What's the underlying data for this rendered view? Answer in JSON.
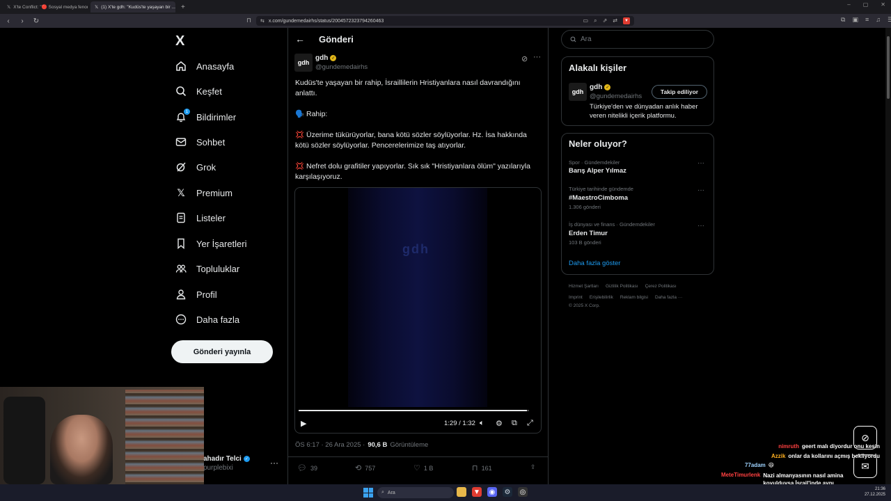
{
  "browser": {
    "tabs": [
      {
        "label": "X'te Conflict: \"🔴 Sosyal medya fenomeni...",
        "active": false
      },
      {
        "label": "(1) X'te gdh: \"Kudüs'te yaşayan bir ...",
        "active": true
      }
    ],
    "url": "x.com/gundemedairhs/status/2004572323794260463"
  },
  "sidebar": {
    "logo": "X",
    "items": [
      {
        "label": "Anasayfa",
        "icon": "home-icon"
      },
      {
        "label": "Keşfet",
        "icon": "search-icon"
      },
      {
        "label": "Bildirimler",
        "icon": "bell-icon",
        "badge": "1"
      },
      {
        "label": "Sohbet",
        "icon": "mail-icon"
      },
      {
        "label": "Grok",
        "icon": "grok-icon"
      },
      {
        "label": "Premium",
        "icon": "x-icon"
      },
      {
        "label": "Listeler",
        "icon": "list-icon"
      },
      {
        "label": "Yer İşaretleri",
        "icon": "bookmark-icon"
      },
      {
        "label": "Topluluklar",
        "icon": "community-icon"
      },
      {
        "label": "Profil",
        "icon": "profile-icon"
      },
      {
        "label": "Daha fazla",
        "icon": "more-circle-icon"
      }
    ],
    "post_button": "Gönderi yayınla",
    "account": {
      "name": "ahadır Telci",
      "handle": "purplebixi"
    }
  },
  "main": {
    "title": "Gönderi",
    "post": {
      "avatar_text": "gdh",
      "author": "gdh",
      "handle": "@gundemedairhs",
      "p1": "Kudüs'te yaşayan bir rahip, İsraillilerin Hristiyanlara nasıl davrandığını anlattı.",
      "p2": "🗣️ Rahip:",
      "p3": "Üzerime tükürüyorlar, bana kötü sözler söylüyorlar. Hz. İsa hakkında kötü sözler söylüyorlar. Pencerelerimize taş atıyorlar.",
      "p4": "Nefret dolu grafitiler yapıyorlar. Sık sık \"Hristiyanlara ölüm\" yazılarıyla karşılaşıyoruz.",
      "video": {
        "watermark": "gdh",
        "time": "1:29 / 1:32",
        "progress": 0.99
      },
      "time": "ÖS 6:17 · 26 Ara 2025 ·",
      "views": "90,6 B",
      "views_label": "Görüntüleme",
      "replies": "39",
      "reposts": "757",
      "likes": "1 B",
      "bookmarks": "161"
    }
  },
  "right": {
    "search_placeholder": "Ara",
    "relevant": {
      "title": "Alakalı kişiler",
      "name": "gdh",
      "handle": "@gundemedairhs",
      "follow_label": "Takip ediliyor",
      "bio": "Türkiye'den ve dünyadan anlık haber veren nitelikli içerik platformu."
    },
    "trends": {
      "title": "Neler oluyor?",
      "items": [
        {
          "meta": "Spor · Gündemdekiler",
          "title": "Barış Alper Yılmaz",
          "count": ""
        },
        {
          "meta": "Türkiye tarihinde gündemde",
          "title": "#MaestroCimboma",
          "count": "1.306 gönderi"
        },
        {
          "meta": "İş dünyası ve finans · Gündemdekiler",
          "title": "Erden Timur",
          "count": "103 B gönderi"
        }
      ],
      "show_more": "Daha fazla göster"
    },
    "footer": {
      "line1": [
        "Hizmet Şartları",
        "Gizlilik Politikası",
        "Çerez Politikası"
      ],
      "line2": [
        "Imprint",
        "Erişilebilirlik",
        "Reklam bilgisi",
        "Daha fazla ···"
      ],
      "copyright": "© 2025 X Corp."
    }
  },
  "chat": [
    {
      "name": "nimruth",
      "color": "#ff4040",
      "text": "geert malı diyordur onu kesin"
    },
    {
      "name": "Azzik",
      "color": "#ffb020",
      "text": "onlar da kollarını açmış bekliyordu"
    },
    {
      "name": "77adam",
      "color": "#9fd3ff",
      "text": "😆"
    },
    {
      "name": "MeteTimurlenk",
      "color": "#ff4040",
      "text": "Nazi almanyasının nasıl amina koyulduysa İsrail'inde aynı muameleyi görmesi gerekiyor"
    }
  ],
  "taskbar": {
    "search": "Ara",
    "time": "21:36",
    "date": "27.12.2025"
  },
  "colors": {
    "accent": "#1d9bf0",
    "gold_badge": "#e2b719",
    "background": "#000000",
    "border": "#2f3336"
  }
}
